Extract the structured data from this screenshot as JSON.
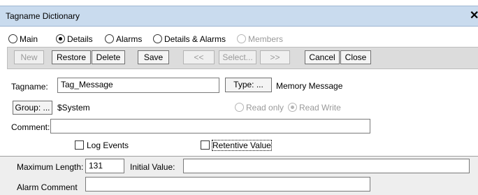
{
  "window": {
    "title": "Tagname Dictionary",
    "close_glyph": "✕"
  },
  "modes": [
    {
      "label": "Main",
      "checked": false,
      "disabled": false
    },
    {
      "label": "Details",
      "checked": true,
      "disabled": false
    },
    {
      "label": "Alarms",
      "checked": false,
      "disabled": false
    },
    {
      "label": "Details & Alarms",
      "checked": false,
      "disabled": false
    },
    {
      "label": "Members",
      "checked": false,
      "disabled": true
    }
  ],
  "toolbar": {
    "new": "New",
    "restore": "Restore",
    "delete": "Delete",
    "save": "Save",
    "prev": "<<",
    "select": "Select...",
    "next": ">>",
    "cancel": "Cancel",
    "close": "Close"
  },
  "form": {
    "tagname_label": "Tagname:",
    "tagname_value": "Tag_Message",
    "type_button": "Type: ...",
    "type_value": "Memory Message",
    "group_button": "Group: ...",
    "group_value": "$System",
    "read_only": "Read only",
    "read_write": "Read Write",
    "comment_label": "Comment:",
    "comment_value": "",
    "log_events": "Log Events",
    "retentive_value": "Retentive Value"
  },
  "details": {
    "max_length_label": "Maximum Length:",
    "max_length_value": "131",
    "initial_value_label": "Initial Value:",
    "initial_value_value": "",
    "alarm_comment_label": "Alarm Comment",
    "alarm_comment_value": ""
  }
}
